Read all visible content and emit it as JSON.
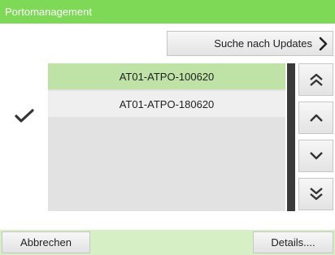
{
  "header": {
    "title": "Portomanagement"
  },
  "toolbar": {
    "update_label": "Suche nach Updates",
    "update_icon": "chevron-right-icon"
  },
  "list": {
    "selected_index": 0,
    "check_icon": "checkmark-icon",
    "items": [
      {
        "label": "AT01-ATPO-100620"
      },
      {
        "label": "AT01-ATPO-180620"
      }
    ]
  },
  "nav": {
    "buttons": [
      {
        "icon": "double-chevron-up-icon"
      },
      {
        "icon": "chevron-up-icon"
      },
      {
        "icon": "chevron-down-icon"
      },
      {
        "icon": "double-chevron-down-icon"
      }
    ]
  },
  "footer": {
    "cancel_label": "Abbrechen",
    "details_label": "Details...."
  },
  "colors": {
    "title_bar": "#7ed956",
    "selected_row": "#bfe3a6",
    "footer_bar": "#d6efc4",
    "scrollbar": "#3a3a3a"
  }
}
